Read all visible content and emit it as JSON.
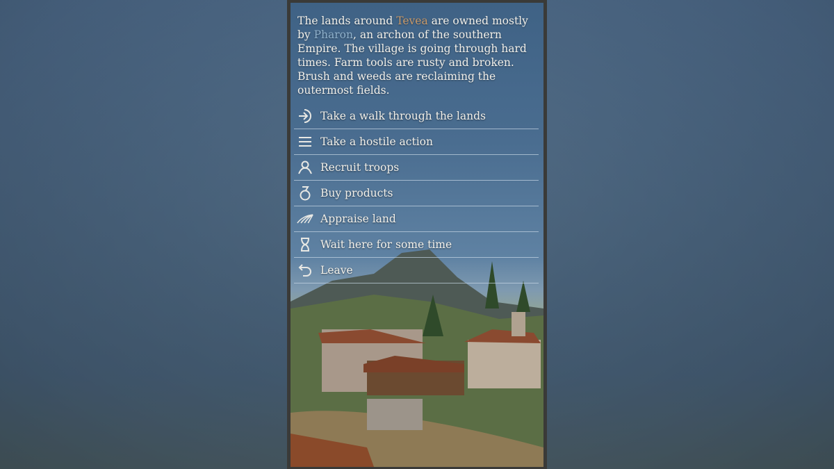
{
  "description": {
    "part1": "The lands around ",
    "village": "Tevea",
    "part2": " are owned mostly by ",
    "owner": "Pharon",
    "part3": ", an archon of the southern Empire. The village is going through hard times. Farm tools are rusty and broken. Brush and weeds are reclaiming the outermost fields."
  },
  "colors": {
    "village_highlight": "#c99a6a",
    "owner_highlight": "#8fb1cc"
  },
  "menu": [
    {
      "label": "Take a walk through the lands",
      "icon": "enter-arrow-icon"
    },
    {
      "label": "Take a hostile action",
      "icon": "menu-lines-icon"
    },
    {
      "label": "Recruit troops",
      "icon": "recruit-person-icon"
    },
    {
      "label": "Buy products",
      "icon": "sack-icon"
    },
    {
      "label": "Appraise land",
      "icon": "field-lines-icon"
    },
    {
      "label": "Wait here for some time",
      "icon": "hourglass-icon"
    },
    {
      "label": "Leave",
      "icon": "return-arrow-icon"
    }
  ]
}
